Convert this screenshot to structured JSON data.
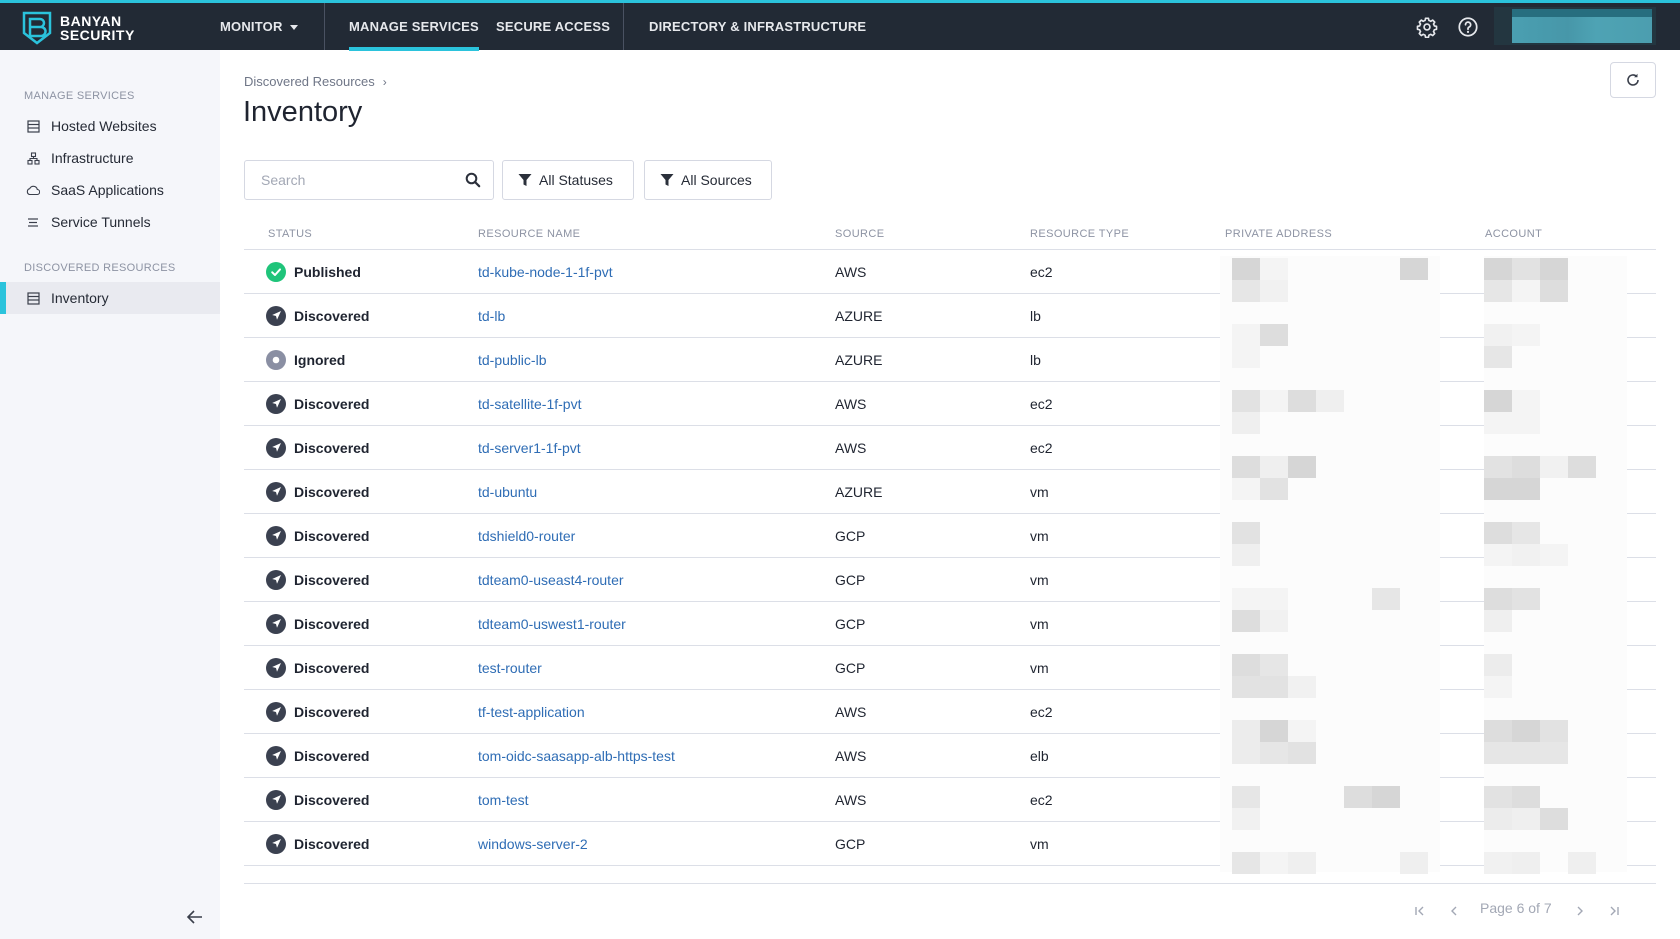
{
  "brand": {
    "line1": "BANYAN",
    "line2": "SECURITY",
    "accent_color": "#2bc3dc"
  },
  "topnav": {
    "items": [
      {
        "label": "MONITOR",
        "has_dropdown": true,
        "active": false
      },
      {
        "label": "MANAGE SERVICES",
        "active": true
      },
      {
        "label": "SECURE ACCESS",
        "active": false
      },
      {
        "label": "DIRECTORY & INFRASTRUCTURE",
        "active": false
      }
    ],
    "icons": [
      "gear-icon",
      "help-icon"
    ],
    "user_menu": "redacted"
  },
  "sidebar": {
    "sections": [
      {
        "title": "MANAGE SERVICES",
        "items": [
          {
            "label": "Hosted Websites",
            "icon": "server-icon"
          },
          {
            "label": "Infrastructure",
            "icon": "network-icon"
          },
          {
            "label": "SaaS Applications",
            "icon": "cloud-icon"
          },
          {
            "label": "Service Tunnels",
            "icon": "lines-icon"
          }
        ]
      },
      {
        "title": "DISCOVERED RESOURCES",
        "items": [
          {
            "label": "Inventory",
            "icon": "server-icon",
            "active": true
          }
        ]
      }
    ],
    "collapse_icon": "arrow-left-icon"
  },
  "breadcrumb": {
    "parent": "Discovered Resources",
    "separator": "›"
  },
  "page": {
    "title": "Inventory"
  },
  "toolbar": {
    "search_placeholder": "Search",
    "search_value": "",
    "status_filter": "All Statuses",
    "source_filter": "All Sources",
    "refresh_icon": "refresh-icon"
  },
  "table": {
    "columns": [
      "STATUS",
      "RESOURCE NAME",
      "SOURCE",
      "RESOURCE TYPE",
      "PRIVATE ADDRESS",
      "ACCOUNT"
    ],
    "rows": [
      {
        "status": "Published",
        "name": "td-kube-node-1-1f-pvt",
        "source": "AWS",
        "type": "ec2"
      },
      {
        "status": "Discovered",
        "name": "td-lb",
        "source": "AZURE",
        "type": "lb"
      },
      {
        "status": "Ignored",
        "name": "td-public-lb",
        "source": "AZURE",
        "type": "lb"
      },
      {
        "status": "Discovered",
        "name": "td-satellite-1f-pvt",
        "source": "AWS",
        "type": "ec2"
      },
      {
        "status": "Discovered",
        "name": "td-server1-1f-pvt",
        "source": "AWS",
        "type": "ec2"
      },
      {
        "status": "Discovered",
        "name": "td-ubuntu",
        "source": "AZURE",
        "type": "vm"
      },
      {
        "status": "Discovered",
        "name": "tdshield0-router",
        "source": "GCP",
        "type": "vm"
      },
      {
        "status": "Discovered",
        "name": "tdteam0-useast4-router",
        "source": "GCP",
        "type": "vm"
      },
      {
        "status": "Discovered",
        "name": "tdteam0-uswest1-router",
        "source": "GCP",
        "type": "vm"
      },
      {
        "status": "Discovered",
        "name": "test-router",
        "source": "GCP",
        "type": "vm"
      },
      {
        "status": "Discovered",
        "name": "tf-test-application",
        "source": "AWS",
        "type": "ec2"
      },
      {
        "status": "Discovered",
        "name": "tom-oidc-saasapp-alb-https-test",
        "source": "AWS",
        "type": "elb"
      },
      {
        "status": "Discovered",
        "name": "tom-test",
        "source": "AWS",
        "type": "ec2"
      },
      {
        "status": "Discovered",
        "name": "windows-server-2",
        "source": "GCP",
        "type": "vm"
      }
    ],
    "private_address": "redacted",
    "account": "redacted"
  },
  "status_colors": {
    "Published": "#1fc47a",
    "Discovered": "#3b4150",
    "Ignored": "#8a8fa3"
  },
  "pagination": {
    "label": "Page 6 of 7",
    "current": 6,
    "total": 7
  }
}
